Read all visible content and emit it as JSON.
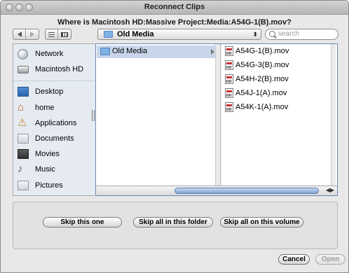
{
  "window": {
    "title": "Reconnect Clips",
    "prompt": "Where is Macintosh HD:Massive Project:Media:A54G-1(B).mov?"
  },
  "toolbar": {
    "location": "Old Media",
    "search_placeholder": "search"
  },
  "sidebar": {
    "devices": [
      {
        "label": "Network",
        "icon": "network-icon"
      },
      {
        "label": "Macintosh HD",
        "icon": "hard-drive-icon"
      }
    ],
    "places": [
      {
        "label": "Desktop",
        "icon": "desktop-icon"
      },
      {
        "label": "home",
        "icon": "home-icon"
      },
      {
        "label": "Applications",
        "icon": "applications-icon"
      },
      {
        "label": "Documents",
        "icon": "documents-icon"
      },
      {
        "label": "Movies",
        "icon": "movies-icon"
      },
      {
        "label": "Music",
        "icon": "music-icon"
      },
      {
        "label": "Pictures",
        "icon": "pictures-icon"
      }
    ]
  },
  "browser": {
    "column1": [
      "Old Media"
    ],
    "column2": [
      "A54G-1(B).mov",
      "A54G-3(B).mov",
      "A54H-2(B).mov",
      "A54J-1(A).mov",
      "A54K-1(A).mov"
    ]
  },
  "skip_buttons": {
    "skip_one": "Skip this one",
    "skip_folder": "Skip all in this folder",
    "skip_volume": "Skip all on this volume"
  },
  "footer": {
    "cancel": "Cancel",
    "open": "Open"
  },
  "colors": {
    "selection": "#c7d6ea",
    "sidebar_bg": "#e6ebf2",
    "window_bg": "#e8e8e8"
  }
}
